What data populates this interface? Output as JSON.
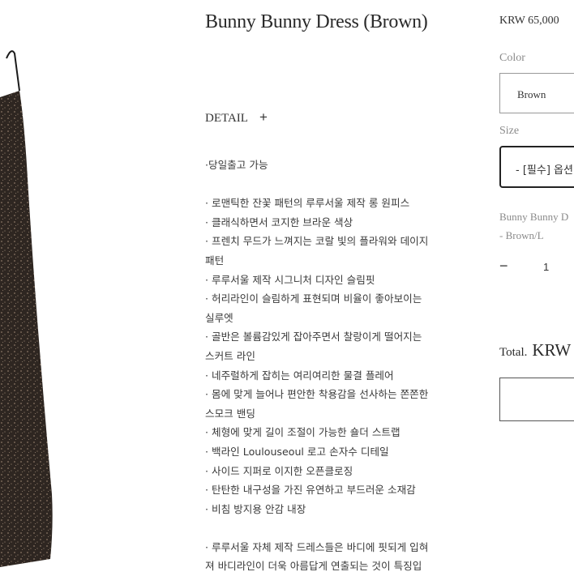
{
  "product": {
    "title": "Bunny Bunny Dress (Brown)",
    "price": "KRW 65,000"
  },
  "detail": {
    "label": "DETAIL",
    "toggle_symbol": "+"
  },
  "description": [
    "·당일출고 가능",
    "",
    "· 로맨틱한 잔꽃 패턴의 루루서울 제작 롱 원피스",
    "· 클래식하면서 코지한 브라운 색상",
    "· 프렌치 무드가 느껴지는 코랄 빛의 플라워와 데이지",
    "패턴",
    "· 루루서울 제작 시그니처 디자인 슬림핏",
    "· 허리라인이 슬림하게 표현되며 비율이 좋아보이는",
    "실루엣",
    "· 골반은 볼륨감있게 잡아주면서 찰랑이게 떨어지는",
    "스커트 라인",
    "· 네주럴하게 잡히는 여리여리한 물결 플레어",
    "· 몸에 맞게 늘어나 편안한 착용감을 선사하는 쫀쫀한",
    "스모크 밴딩",
    "· 체형에 맞게 길이 조절이 가능한 숄더 스트랩",
    "· 백라인 Loulouseoul 로고 손자수 디테일",
    "· 사이드 지퍼로 이지한 오픈클로징",
    "· 탄탄한 내구성을 가진 유연하고 부드러운 소재감",
    "· 비침 방지용 안감 내장",
    "",
    "· 루루서울 자체 제작 드레스들은 바디에 핏되게 입혀",
    "져 바디라인이 더욱 아름답게 연출되는 것이 특징입"
  ],
  "options": {
    "color_label": "Color",
    "color_value": "Brown",
    "size_label": "Size",
    "size_value": "- [필수] 옵션",
    "selected_name_line1": "Bunny Bunny D",
    "selected_name_line2": "- Brown/L"
  },
  "quantity": {
    "minus": "−",
    "value": "1"
  },
  "total": {
    "label": "Total.",
    "currency": "KRW"
  }
}
